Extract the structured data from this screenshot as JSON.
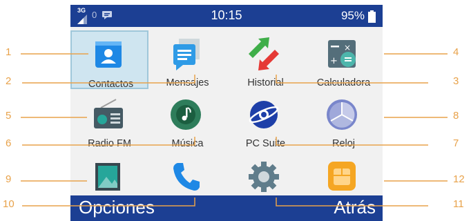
{
  "status_bar": {
    "network": "3G",
    "indicator": "0",
    "time": "10:15",
    "battery": "95%"
  },
  "apps": [
    {
      "label": "Contactos",
      "icon": "contacts-icon",
      "selected": true
    },
    {
      "label": "Mensajes",
      "icon": "messages-icon"
    },
    {
      "label": "Historial",
      "icon": "call-history-icon"
    },
    {
      "label": "Calculadora",
      "icon": "calculator-icon"
    },
    {
      "label": "Radio FM",
      "icon": "radio-icon"
    },
    {
      "label": "Música",
      "icon": "music-icon"
    },
    {
      "label": "PC Suite",
      "icon": "pc-suite-icon"
    },
    {
      "label": "Reloj",
      "icon": "clock-icon"
    },
    {
      "label": "",
      "icon": "gallery-icon"
    },
    {
      "label": "",
      "icon": "phone-icon"
    },
    {
      "label": "",
      "icon": "settings-icon"
    },
    {
      "label": "",
      "icon": "sim-icon"
    }
  ],
  "softkeys": {
    "left": "Opciones",
    "right": "Atrás"
  },
  "callouts": [
    "1",
    "2",
    "3",
    "4",
    "5",
    "6",
    "7",
    "8",
    "9",
    "10",
    "11",
    "12"
  ],
  "colors": {
    "statusbar": "#1c3f93",
    "callout": "#e8a24a",
    "selected_bg": "#cfe5f0"
  }
}
